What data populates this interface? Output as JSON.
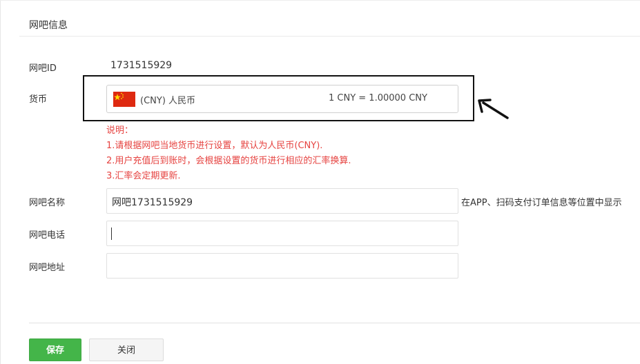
{
  "section": {
    "title": "网吧信息"
  },
  "cafe_id": {
    "label": "网吧ID",
    "value": "1731515929"
  },
  "currency": {
    "label": "货币",
    "name": "(CNY) 人民币",
    "rate": "1 CNY = 1.00000 CNY",
    "flag": "china-flag-icon"
  },
  "notes": {
    "title": "说明：",
    "lines": [
      "1.请根据网吧当地货币进行设置，默认为人民币(CNY).",
      "2.用户充值后到账时，会根据设置的货币进行相应的汇率换算.",
      "3.汇率会定期更新."
    ]
  },
  "fields": {
    "name": {
      "label": "网吧名称",
      "value": "网吧1731515929",
      "hint": "在APP、扫码支付订单信息等位置中显示"
    },
    "phone": {
      "label": "网吧电话",
      "value": ""
    },
    "address": {
      "label": "网吧地址",
      "value": ""
    }
  },
  "buttons": {
    "save": "保存",
    "close": "关闭"
  },
  "colors": {
    "primary": "#44b549",
    "note": "#e64340"
  }
}
